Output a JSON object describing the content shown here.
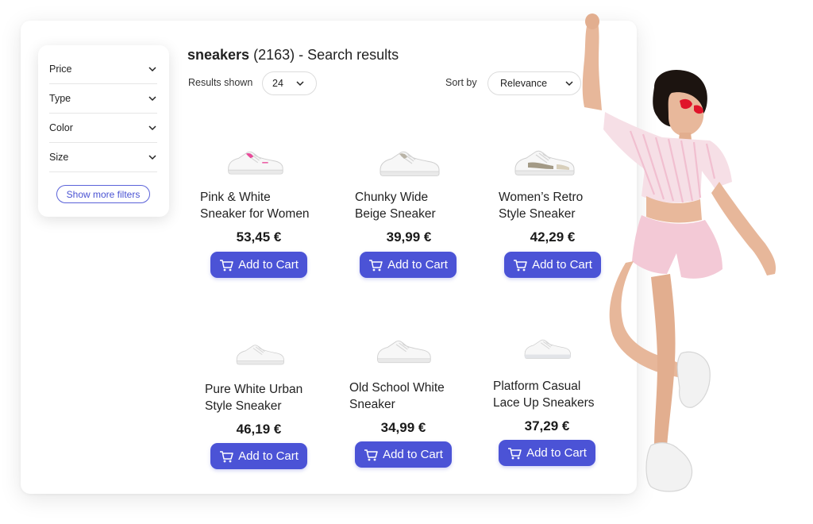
{
  "filters": {
    "items": [
      {
        "label": "Price"
      },
      {
        "label": "Type"
      },
      {
        "label": "Color"
      },
      {
        "label": "Size"
      }
    ],
    "more_label": "Show more filters"
  },
  "header": {
    "query": "sneakers",
    "count": "(2163)",
    "suffix": "- Search results"
  },
  "controls": {
    "results_label": "Results shown",
    "results_value": "24",
    "sort_label": "Sort by",
    "sort_value": "Relevance"
  },
  "products": [
    {
      "name": "Pink & White\nSneaker for Women",
      "price": "53,45 €",
      "cart_label": "Add to Cart",
      "accent": "#e94a9a"
    },
    {
      "name": "Chunky Wide\nBeige Sneaker",
      "price": "39,99 €",
      "cart_label": "Add to Cart",
      "accent": "#d9d4c9"
    },
    {
      "name": "Women’s Retro\nStyle Sneaker",
      "price": "42,29 €",
      "cart_label": "Add to Cart",
      "accent": "#a39a86"
    },
    {
      "name": "Pure White Urban\nStyle Sneaker",
      "price": "46,19 €",
      "cart_label": "Add to Cart",
      "accent": "#e8e4dc"
    },
    {
      "name": "Old School White\nSneaker",
      "price": "34,99 €",
      "cart_label": "Add to Cart",
      "accent": "#dcdcdc"
    },
    {
      "name": "Platform Casual\nLace Up Sneakers",
      "price": "37,29 €",
      "cart_label": "Add to Cart",
      "accent": "#c9ccd2"
    }
  ],
  "colors": {
    "accent": "#4b53d6",
    "outfit_pink": "#f3c9d6",
    "sunglasses": "#e0142a"
  }
}
